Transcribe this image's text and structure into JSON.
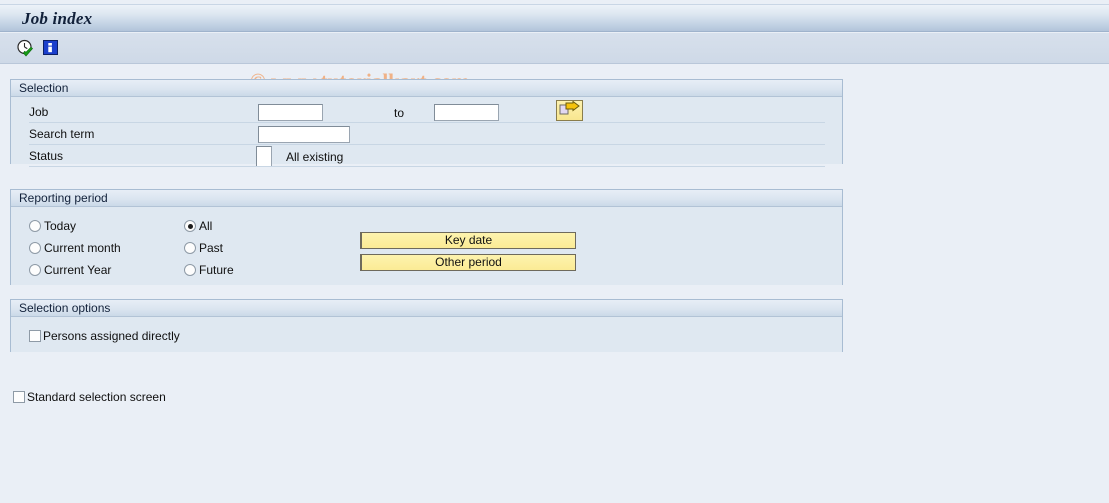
{
  "window": {
    "title": "Job index"
  },
  "toolbar": {
    "icons": [
      {
        "name": "execute-clock-icon",
        "label": "Execute"
      },
      {
        "name": "info-icon",
        "label": "Information"
      }
    ]
  },
  "watermark": {
    "text": "© www.tutorialkart.com"
  },
  "selection_group": {
    "header": "Selection",
    "fields": {
      "job": {
        "label": "Job",
        "from_value": "",
        "from_placeholder": "",
        "to_label": "to",
        "to_value": "",
        "to_placeholder": "",
        "multi_select_icon": "multiple-selection-arrow-icon"
      },
      "search_term": {
        "label": "Search term",
        "value": "",
        "placeholder": ""
      },
      "status": {
        "label": "Status",
        "value": "",
        "placeholder": "",
        "description": "All existing"
      }
    }
  },
  "reporting_group": {
    "header": "Reporting period",
    "radios_left": [
      {
        "label": "Today",
        "checked": false
      },
      {
        "label": "Current month",
        "checked": false
      },
      {
        "label": "Current Year",
        "checked": false
      }
    ],
    "radios_right": [
      {
        "label": "All",
        "checked": true
      },
      {
        "label": "Past",
        "checked": false
      },
      {
        "label": "Future",
        "checked": false
      }
    ],
    "buttons": {
      "key_date": "Key date",
      "other_period": "Other period"
    }
  },
  "options_group": {
    "header": "Selection options",
    "checkbox": {
      "label": "Persons assigned directly",
      "checked": false
    }
  },
  "footer": {
    "standard_selection_screen": {
      "label": "Standard selection screen",
      "checked": false
    }
  },
  "colors": {
    "page_background": "#eaeff6",
    "group_background": "#dfe8f1",
    "group_border": "#a8bcd2",
    "title_gradient_start": "#edf2f8",
    "title_gradient_end": "#b2c4da",
    "button_yellow": "#fbeb95",
    "watermark": "#f0b287",
    "info_icon_blue": "#1b3fcc",
    "check_green": "#159b16"
  }
}
